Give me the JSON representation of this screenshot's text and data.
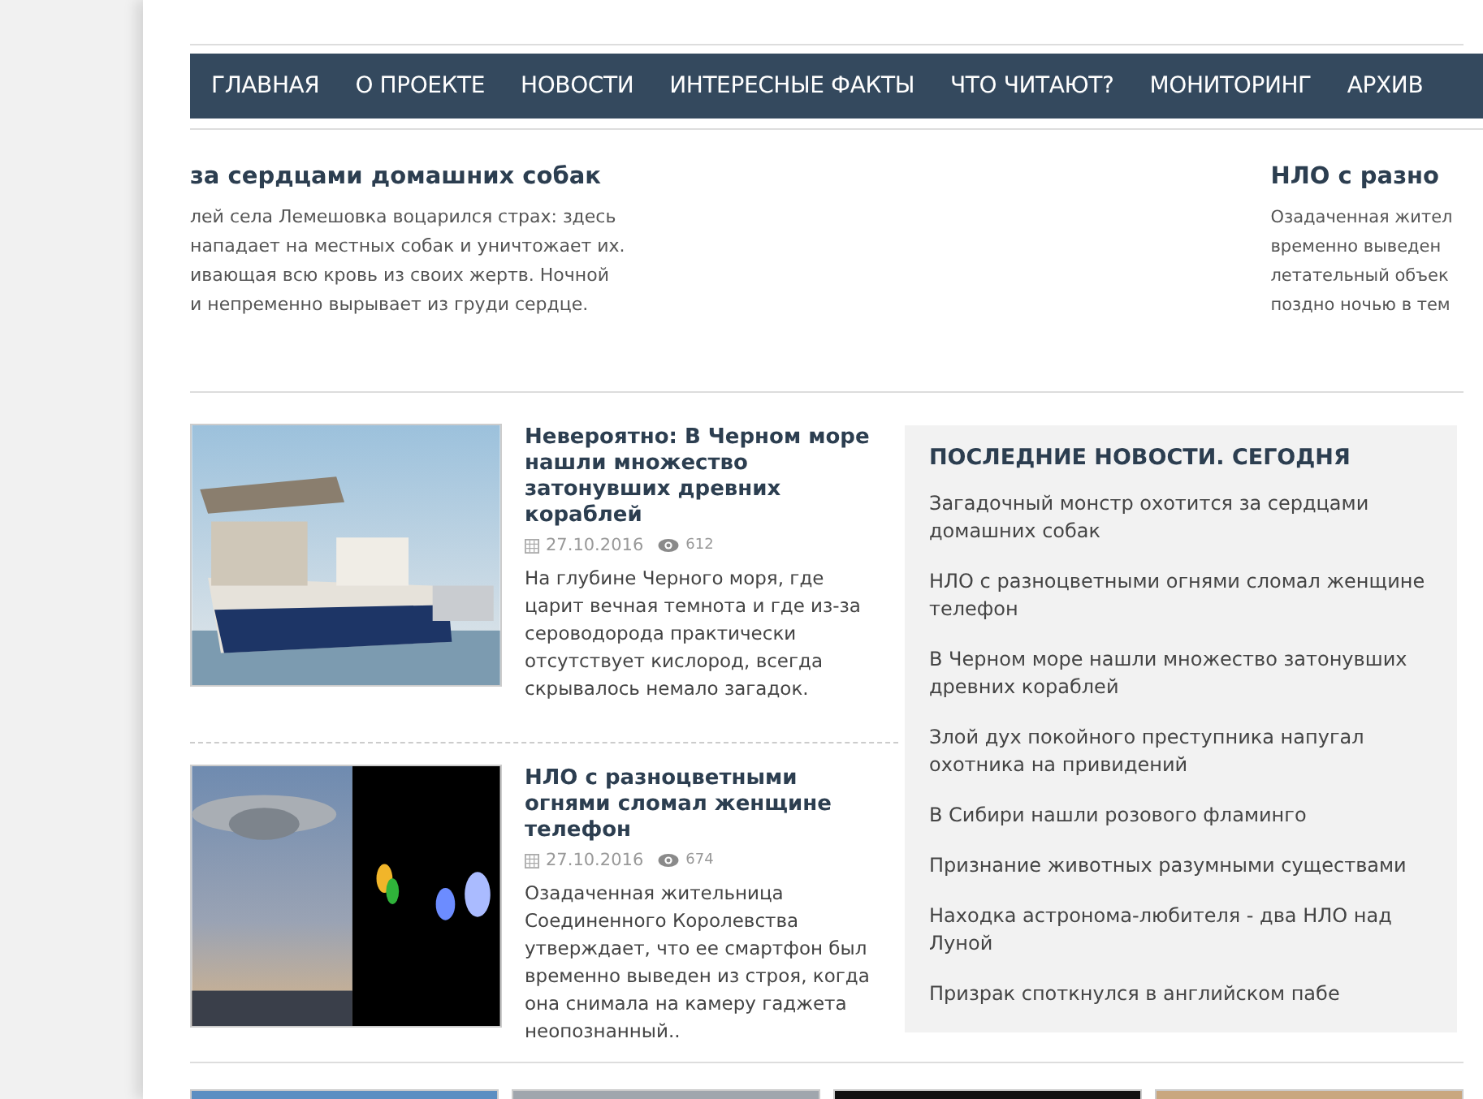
{
  "nav": [
    {
      "label": "ГЛАВНАЯ"
    },
    {
      "label": "О ПРОЕКТЕ"
    },
    {
      "label": "НОВОСТИ"
    },
    {
      "label": "ИНТЕРЕСНЫЕ ФАКТЫ"
    },
    {
      "label": "ЧТО ЧИТАЮТ?"
    },
    {
      "label": "МОНИТОРИНГ"
    },
    {
      "label": "АРХИВ"
    }
  ],
  "slider": [
    {
      "title": "за сердцами домашних собак",
      "lines": [
        "лей села Лемешовка воцарился страх: здесь",
        "нападает на местных собак и уничтожает их.",
        "ивающая всю кровь из своих жертв. Ночной",
        "и непременно вырывает из груди сердце."
      ]
    },
    {
      "title": "НЛО с разно",
      "lines": [
        "Озадаченная жител",
        "временно выведен",
        "летательный объек",
        "поздно ночью в тем"
      ]
    }
  ],
  "articles": [
    {
      "kind": "ship",
      "title": "Невероятно: В Черном море нашли множество затонувших древних кораблей",
      "date": "27.10.2016",
      "views": "612",
      "text": "На глубине Черного моря, где царит вечная темнота и где из-за сероводорода практически отсутствует кислород, всегда скрывалось немало загадок."
    },
    {
      "kind": "ufo",
      "title": "НЛО с разноцветными огнями сломал женщине телефон",
      "date": "27.10.2016",
      "views": "674",
      "text": "Озадаченная жительница Соединенного Королевства утверждает, что ее смартфон был временно выведен из строя, когда она снимала на камеру гаджета неопознанный.."
    }
  ],
  "latest": {
    "heading": "ПОСЛЕДНИЕ НОВОСТИ. СЕГОДНЯ",
    "items": [
      "Загадочный монстр охотится за сердцами домашних собак",
      "НЛО с разноцветными огнями сломал женщине телефон",
      "В Черном море нашли множество затонувших древних кораблей",
      "Злой дух покойного преступника напугал охотника на привидений",
      "В Сибири нашли розового фламинго",
      "Признание животных разумными существами",
      "Находка астронома-любителя - два НЛО над Луной",
      "Призрак споткнулся в английском пабе"
    ]
  }
}
